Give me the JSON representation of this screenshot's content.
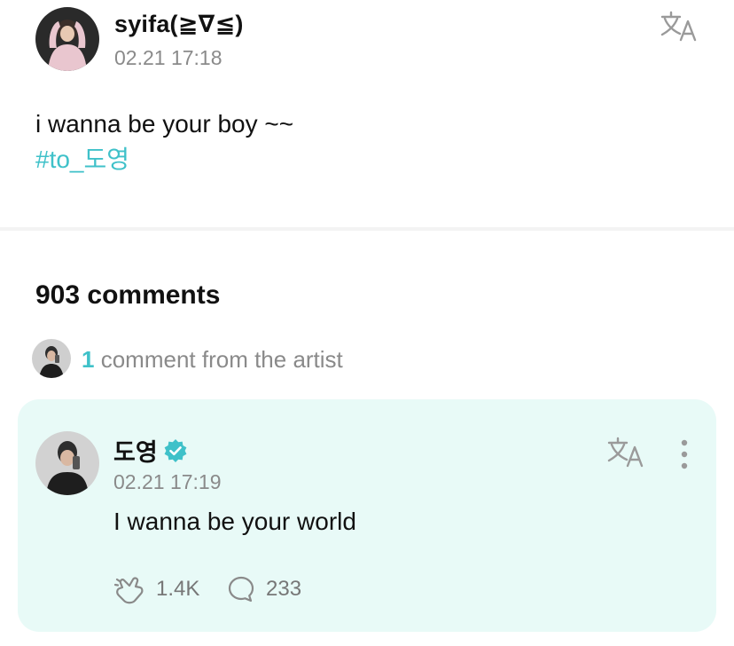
{
  "post": {
    "author": "syifa(≧∇≦)",
    "timestamp": "02.21 17:18",
    "text": "i wanna be your boy ~~",
    "hashtag": "#to_도영",
    "translate_icon": "translate-icon"
  },
  "comments": {
    "count_label": "903 comments"
  },
  "artist_summary": {
    "count": "1",
    "label": "comment from the artist"
  },
  "artist_comment": {
    "author": "도영",
    "verified_icon": "verified-badge-icon",
    "timestamp": "02.21 17:19",
    "text": "I wanna be your world",
    "likes": "1.4K",
    "replies": "233",
    "like_icon": "like-icon",
    "reply_icon": "comment-bubble-icon",
    "more_icon": "more-vertical-icon"
  },
  "colors": {
    "accent": "#3fc1c9",
    "card_background": "#e8faf7",
    "muted_text": "#8a8a8a",
    "divider": "#f3f3f3"
  }
}
